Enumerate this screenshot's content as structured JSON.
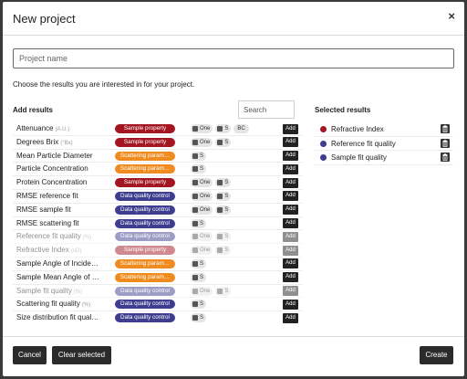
{
  "modal": {
    "title": "New project",
    "close_icon": "×",
    "project_name_placeholder": "Project name",
    "instructions": "Choose the results you are interested in for your project."
  },
  "add_results": {
    "title": "Add results",
    "search_placeholder": "Search",
    "add_label": "Add",
    "rows": [
      {
        "name": "Attenuance",
        "unit": "(A.U.)",
        "category": "Sample property",
        "color": "#a31621",
        "chips": [
          "One",
          "S",
          "BC"
        ],
        "dim": false
      },
      {
        "name": "Degrees Brix",
        "unit": "(°Bx)",
        "category": "Sample property",
        "color": "#a31621",
        "chips": [
          "One",
          "S"
        ],
        "dim": false
      },
      {
        "name": "Mean Particle Diameter",
        "unit": "",
        "category": "Scattering param…",
        "color": "#f08c1f",
        "chips": [
          "S"
        ],
        "dim": false
      },
      {
        "name": "Particle Concentration",
        "unit": "",
        "category": "Scattering param…",
        "color": "#f08c1f",
        "chips": [
          "S"
        ],
        "dim": false
      },
      {
        "name": "Protein Concentration",
        "unit": "",
        "category": "Sample property",
        "color": "#a31621",
        "chips": [
          "One",
          "S"
        ],
        "dim": false
      },
      {
        "name": "RMSE reference fit",
        "unit": "",
        "category": "Data quality control",
        "color": "#3f3d8f",
        "chips": [
          "One",
          "S"
        ],
        "dim": false
      },
      {
        "name": "RMSE sample fit",
        "unit": "",
        "category": "Data quality control",
        "color": "#3f3d8f",
        "chips": [
          "One",
          "S"
        ],
        "dim": false
      },
      {
        "name": "RMSE scattering fit",
        "unit": "",
        "category": "Data quality control",
        "color": "#3f3d8f",
        "chips": [
          "S"
        ],
        "dim": false
      },
      {
        "name": "Reference fit quality",
        "unit": "(%)",
        "category": "Data quality control",
        "color": "#3f3d8f",
        "chips": [
          "One",
          "S"
        ],
        "dim": true
      },
      {
        "name": "Refractive Index",
        "unit": "(nD)",
        "category": "Sample property",
        "color": "#a31621",
        "chips": [
          "One",
          "S"
        ],
        "dim": true
      },
      {
        "name": "Sample Angle of Incide…",
        "unit": "",
        "category": "Scattering param…",
        "color": "#f08c1f",
        "chips": [
          "S"
        ],
        "dim": false
      },
      {
        "name": "Sample Mean Angle of …",
        "unit": "",
        "category": "Scattering param…",
        "color": "#f08c1f",
        "chips": [
          "S"
        ],
        "dim": false
      },
      {
        "name": "Sample fit quality",
        "unit": "(%)",
        "category": "Data quality control",
        "color": "#3f3d8f",
        "chips": [
          "One",
          "S"
        ],
        "dim": true
      },
      {
        "name": "Scattering fit quality",
        "unit": "(%)",
        "category": "Data quality control",
        "color": "#3f3d8f",
        "chips": [
          "S"
        ],
        "dim": false
      },
      {
        "name": "Size distribution fit qual…",
        "unit": "",
        "category": "Data quality control",
        "color": "#3f3d8f",
        "chips": [
          "S"
        ],
        "dim": false
      }
    ]
  },
  "selected_results": {
    "title": "Selected results",
    "items": [
      {
        "name": "Refractive Index",
        "color": "#a31621"
      },
      {
        "name": "Reference fit quality",
        "color": "#3f3d8f"
      },
      {
        "name": "Sample fit quality",
        "color": "#3f3d8f"
      }
    ]
  },
  "footer": {
    "cancel_label": "Cancel",
    "clear_label": "Clear selected",
    "create_label": "Create"
  }
}
